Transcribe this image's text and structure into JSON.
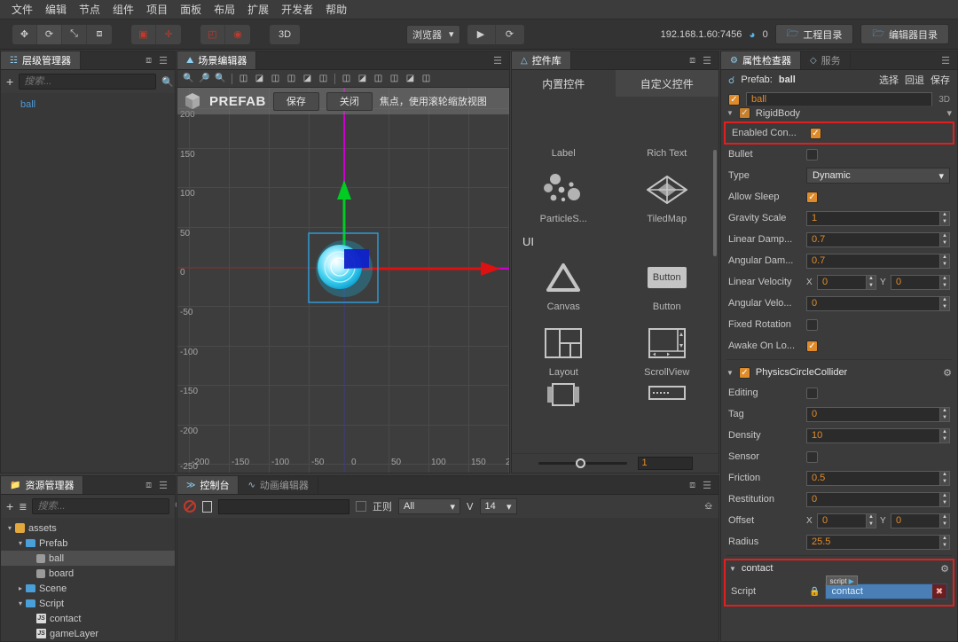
{
  "menubar": {
    "items": [
      "文件",
      "编辑",
      "节点",
      "组件",
      "项目",
      "面板",
      "布局",
      "扩展",
      "开发者",
      "帮助"
    ]
  },
  "toolbar": {
    "transform_tools": [
      {
        "name": "move-tool",
        "glyph": "✥"
      },
      {
        "name": "rotate-tool",
        "glyph": "⟳"
      },
      {
        "name": "scale-tool",
        "glyph": "⤡"
      },
      {
        "name": "rect-tool",
        "glyph": "⧈"
      }
    ],
    "pivot_tools": [
      {
        "name": "pivot-center-tool",
        "glyph": "▣"
      },
      {
        "name": "pivot-anchor-tool",
        "glyph": "✛"
      }
    ],
    "coord_tools": [
      {
        "name": "local-coord-tool",
        "glyph": "◰"
      },
      {
        "name": "global-coord-tool",
        "glyph": "◉"
      }
    ],
    "mode_3d_label": "3D",
    "preview_target": "浏览器",
    "play_glyph": "▶",
    "refresh_glyph": "⟳",
    "address": "192.168.1.60:7456",
    "device_count": "0",
    "project_dir_label": "工程目录",
    "editor_dir_label": "编辑器目录"
  },
  "hierarchy": {
    "tab_label": "层级管理器",
    "search_placeholder": "搜索...",
    "nodes": [
      {
        "label": "ball",
        "selected": true
      }
    ]
  },
  "assets": {
    "tab_label": "资源管理器",
    "search_placeholder": "搜索...",
    "tree": [
      {
        "label": "assets",
        "depth": 0,
        "type": "assets",
        "arrow": "▾",
        "selected": false
      },
      {
        "label": "Prefab",
        "depth": 1,
        "type": "folder",
        "arrow": "▾",
        "selected": false
      },
      {
        "label": "ball",
        "depth": 2,
        "type": "prefab",
        "arrow": "",
        "selected": true
      },
      {
        "label": "board",
        "depth": 2,
        "type": "prefab",
        "arrow": "",
        "selected": false
      },
      {
        "label": "Scene",
        "depth": 1,
        "type": "folder",
        "arrow": "▸",
        "selected": false
      },
      {
        "label": "Script",
        "depth": 1,
        "type": "folder",
        "arrow": "▾",
        "selected": false
      },
      {
        "label": "contact",
        "depth": 2,
        "type": "js",
        "arrow": "",
        "selected": false
      },
      {
        "label": "gameLayer",
        "depth": 2,
        "type": "js",
        "arrow": "",
        "selected": false
      }
    ]
  },
  "scene": {
    "tab_label": "场景编辑器",
    "prefab_mode_label": "PREFAB",
    "save_label": "保存",
    "close_label": "关闭",
    "hint_text": "焦点，使用滚轮缩放视图",
    "x_ticks": [
      "-200",
      "-150",
      "-100",
      "-50",
      "0",
      "50",
      "100",
      "150",
      "2"
    ],
    "y_ticks": [
      "200",
      "150",
      "100",
      "50",
      "0",
      "-50",
      "-100",
      "-150",
      "-200"
    ],
    "corner_label": "-250"
  },
  "widgets": {
    "tab_label": "控件库",
    "tabs": [
      {
        "label": "内置控件",
        "selected": true
      },
      {
        "label": "自定义控件",
        "selected": false
      }
    ],
    "items": [
      {
        "label": "Label",
        "icon": "label-icon"
      },
      {
        "label": "Rich Text",
        "icon": "richtext-icon"
      },
      {
        "label": "ParticleS...",
        "icon": "particle-icon"
      },
      {
        "label": "TiledMap",
        "icon": "tiledmap-icon"
      },
      {
        "label": "Canvas",
        "icon": "canvas-icon"
      },
      {
        "label": "Button",
        "icon": "button-icon"
      },
      {
        "label": "Layout",
        "icon": "layout-icon"
      },
      {
        "label": "ScrollView",
        "icon": "scrollview-icon"
      }
    ],
    "section_ui_label": "UI",
    "zoom_value": "1"
  },
  "console": {
    "tabs": [
      {
        "label": "控制台",
        "selected": true
      },
      {
        "label": "动画编辑器",
        "selected": false
      }
    ],
    "filter_value": "",
    "regex_label": "正则",
    "level_value": "All",
    "font_size_value": "14"
  },
  "inspector": {
    "tabs": [
      {
        "label": "属性检查器",
        "selected": true
      },
      {
        "label": "服务",
        "selected": false
      }
    ],
    "prefab_label": "Prefab:",
    "prefab_name": "ball",
    "prefab_actions": [
      "选择",
      "回退",
      "保存"
    ],
    "node_name": "ball",
    "mode_3d": "3D",
    "rigidbody": {
      "title": "RigidBody",
      "enabled": true,
      "props": [
        {
          "label": "Enabled Con...",
          "type": "check",
          "value": true,
          "highlight": true
        },
        {
          "label": "Bullet",
          "type": "check",
          "value": false
        },
        {
          "label": "Type",
          "type": "select",
          "value": "Dynamic"
        },
        {
          "label": "Allow Sleep",
          "type": "check",
          "value": true
        },
        {
          "label": "Gravity Scale",
          "type": "number",
          "value": "1"
        },
        {
          "label": "Linear Damp...",
          "type": "number",
          "value": "0.7"
        },
        {
          "label": "Angular Dam...",
          "type": "number",
          "value": "0.7"
        },
        {
          "label": "Linear Velocity",
          "type": "xy",
          "x": "0",
          "y": "0"
        },
        {
          "label": "Angular Velo...",
          "type": "number",
          "value": "0"
        },
        {
          "label": "Fixed Rotation",
          "type": "check",
          "value": false
        },
        {
          "label": "Awake On Lo...",
          "type": "check",
          "value": true
        }
      ]
    },
    "collider": {
      "title": "PhysicsCircleCollider",
      "enabled": true,
      "props": [
        {
          "label": "Editing",
          "type": "check",
          "value": false
        },
        {
          "label": "Tag",
          "type": "number",
          "value": "0"
        },
        {
          "label": "Density",
          "type": "number",
          "value": "10"
        },
        {
          "label": "Sensor",
          "type": "check",
          "value": false
        },
        {
          "label": "Friction",
          "type": "number",
          "value": "0.5"
        },
        {
          "label": "Restitution",
          "type": "number",
          "value": "0"
        },
        {
          "label": "Offset",
          "type": "xy",
          "x": "0",
          "y": "0"
        },
        {
          "label": "Radius",
          "type": "number",
          "value": "25.5"
        }
      ]
    },
    "contact": {
      "title": "contact",
      "script_label": "Script",
      "script_value": "contact",
      "tooltip_label": "script"
    }
  }
}
